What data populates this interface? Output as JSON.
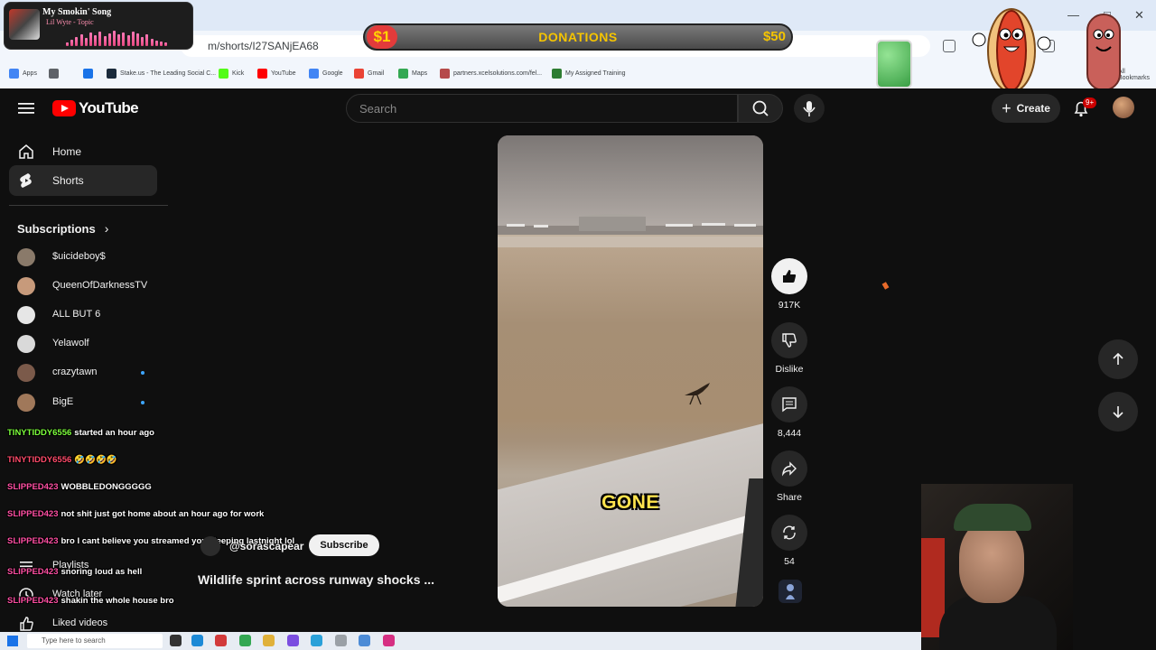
{
  "browser": {
    "url": "m/shorts/I27SANjEA68",
    "profile_chip": "mini",
    "bookmarks": [
      {
        "label": "Apps",
        "color": "#4285f4"
      },
      {
        "label": "",
        "color": "#5f6368"
      },
      {
        "label": "",
        "color": "#1a73e8"
      },
      {
        "label": "Stake.us - The Leading Social C...",
        "color": "#1b2b3c"
      },
      {
        "label": "Kick",
        "color": "#53fc18"
      },
      {
        "label": "YouTube",
        "color": "#ff0000"
      },
      {
        "label": "Google",
        "color": "#4285f4"
      },
      {
        "label": "Gmail",
        "color": "#ea4335"
      },
      {
        "label": "Maps",
        "color": "#34a853"
      },
      {
        "label": "partners.xcelsolutions.com/fel...",
        "color": "#b54a4a"
      },
      {
        "label": "My Assigned Training",
        "color": "#2e7d32"
      }
    ],
    "all_bookmarks": "All Bookmarks"
  },
  "overlay": {
    "now_playing": {
      "title": "My Smokin' Song",
      "artist": "Lil Wyte - Topic"
    },
    "donation": {
      "start": "$1",
      "label": "DONATIONS",
      "goal": "$50"
    }
  },
  "header": {
    "logo_text": "YouTube",
    "search_placeholder": "Search",
    "create_label": "Create",
    "notification_count": "9+"
  },
  "sidebar": {
    "nav": [
      {
        "label": "Home",
        "icon": "home-icon"
      },
      {
        "label": "Shorts",
        "icon": "shorts-icon",
        "active": true
      }
    ],
    "subscriptions_heading": "Subscriptions",
    "subscriptions": [
      {
        "name": "$uicideboy$",
        "color": "#8a7a6a",
        "live": false
      },
      {
        "name": "QueenOfDarknessTV",
        "color": "#c79a7b",
        "live": false
      },
      {
        "name": "ALL BUT 6",
        "color": "#e6e6e6",
        "live": false
      },
      {
        "name": "Yelawolf",
        "color": "#d9d9d9",
        "live": false
      },
      {
        "name": "crazytawn",
        "color": "#7b5a4a",
        "live": true
      },
      {
        "name": "BigE",
        "color": "#a0785a",
        "live": true
      }
    ],
    "lower_nav": [
      {
        "label": "Playlists",
        "icon": "playlists-icon"
      },
      {
        "label": "Watch later",
        "icon": "watch-later-icon"
      },
      {
        "label": "Liked videos",
        "icon": "liked-videos-icon"
      }
    ]
  },
  "chat": [
    {
      "user": "TINYTIDDY6556",
      "color": "#7dff3c",
      "msg": "started an hour ago"
    },
    {
      "user": "TINYTIDDY6556",
      "color": "#ff4b6a",
      "msg": "🤣🤣🤣🤣"
    },
    {
      "user": "SLIPPED423",
      "color": "#ff4fa3",
      "msg": "WOBBLEDONGGGGG"
    },
    {
      "user": "SLIPPED423",
      "color": "#ff4fa3",
      "msg": "not shit just got home about an hour ago for work"
    },
    {
      "user": "SLIPPED423",
      "color": "#ff4fa3",
      "msg": "bro I cant believe you streamed you sleeping lastnight lol"
    },
    {
      "user": "SLIPPED423",
      "color": "#ff4fa3",
      "msg": "snoring loud as hell"
    },
    {
      "user": "SLIPPED423",
      "color": "#ff4fa3",
      "msg": "shakin the whole house bro"
    }
  ],
  "short": {
    "caption": "GONE",
    "channel": "@sorascapear",
    "subscribe_label": "Subscribe",
    "title": "Wildlife sprint across runway shocks ...",
    "likes": "917K",
    "dislike_label": "Dislike",
    "comments": "8,444",
    "share_label": "Share",
    "remix_count": "54"
  },
  "taskbar": {
    "search_placeholder": "Type here to search"
  }
}
